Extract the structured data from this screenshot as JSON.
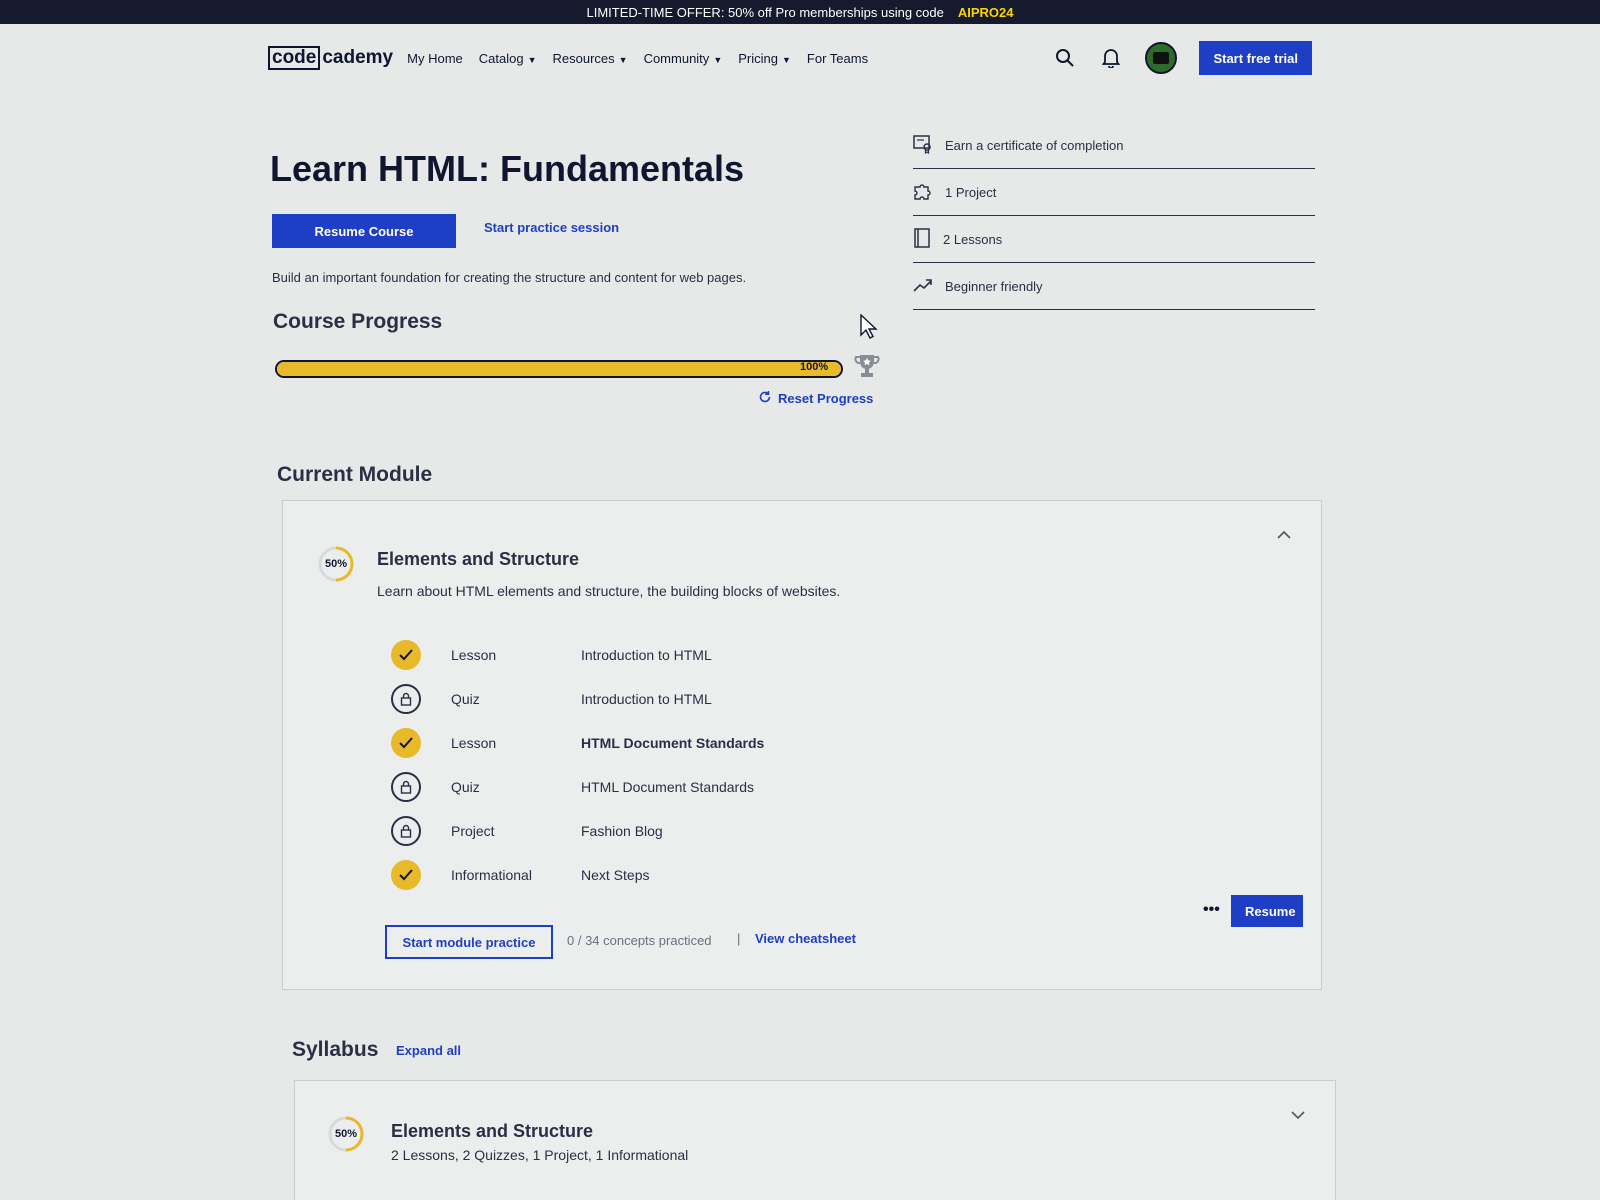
{
  "promo": {
    "text": "LIMITED-TIME OFFER: 50% off Pro memberships using code",
    "code": "AIPRO24"
  },
  "nav": {
    "logo_box": "code",
    "logo_rest": "cademy",
    "links": [
      {
        "label": "My Home",
        "dropdown": false
      },
      {
        "label": "Catalog",
        "dropdown": true
      },
      {
        "label": "Resources",
        "dropdown": true
      },
      {
        "label": "Community",
        "dropdown": true
      },
      {
        "label": "Pricing",
        "dropdown": true
      },
      {
        "label": "For Teams",
        "dropdown": false
      }
    ],
    "cta": "Start free trial"
  },
  "course": {
    "title": "Learn HTML: Fundamentals",
    "resume_label": "Resume Course",
    "practice_label": "Start practice session",
    "description": "Build an important foundation for creating the structure and content for web pages.",
    "progress_title": "Course Progress",
    "progress_value": 1.0,
    "progress_label": "100%",
    "reset_label": "Reset Progress"
  },
  "info": [
    {
      "icon": "certificate-icon",
      "label": "Earn a certificate of completion"
    },
    {
      "icon": "puzzle-icon",
      "label": "1 Project"
    },
    {
      "icon": "book-icon",
      "label": "2 Lessons"
    },
    {
      "icon": "trend-up-icon",
      "label": "Beginner friendly"
    }
  ],
  "current_module": {
    "heading": "Current Module",
    "percent_label": "50%",
    "percent_value": 0.5,
    "name": "Elements and Structure",
    "description": "Learn about HTML elements and structure, the building blocks of websites.",
    "items": [
      {
        "status": "done",
        "type": "Lesson",
        "name": "Introduction to HTML",
        "bold": false
      },
      {
        "status": "locked",
        "type": "Quiz",
        "name": "Introduction to HTML",
        "bold": false
      },
      {
        "status": "done",
        "type": "Lesson",
        "name": "HTML Document Standards",
        "bold": true
      },
      {
        "status": "locked",
        "type": "Quiz",
        "name": "HTML Document Standards",
        "bold": false
      },
      {
        "status": "locked",
        "type": "Project",
        "name": "Fashion Blog",
        "bold": false
      },
      {
        "status": "done",
        "type": "Informational",
        "name": "Next Steps",
        "bold": false
      }
    ],
    "module_practice_label": "Start module practice",
    "concepts_label": "0 / 34 concepts practiced",
    "separator": "|",
    "cheatsheet_label": "View cheatsheet",
    "more_label": "•••",
    "resume_label": "Resume"
  },
  "syllabus": {
    "heading": "Syllabus",
    "expand_label": "Expand all",
    "modules": [
      {
        "percent_label": "50%",
        "percent_value": 0.5,
        "name": "Elements and Structure",
        "summary": "2 Lessons, 2 Quizzes, 1 Project, 1 Informational"
      }
    ]
  },
  "colors": {
    "accent": "#1f3ec6",
    "progress": "#e8b928",
    "dark": "#10162f",
    "banner": "#151a2e",
    "promo_code": "#ffd300"
  }
}
